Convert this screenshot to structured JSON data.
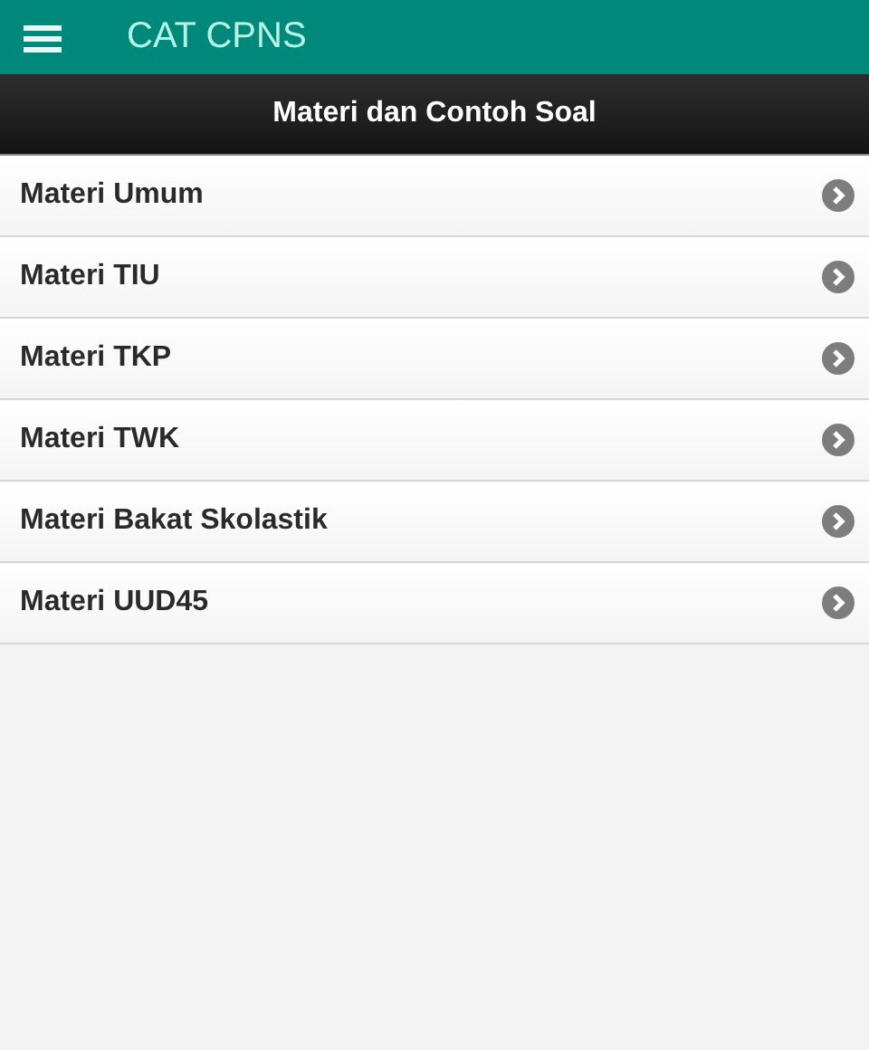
{
  "app_bar": {
    "title": "CAT CPNS"
  },
  "header": {
    "title": "Materi dan Contoh Soal"
  },
  "items": [
    {
      "label": "Materi Umum"
    },
    {
      "label": "Materi TIU"
    },
    {
      "label": "Materi TKP"
    },
    {
      "label": "Materi TWK"
    },
    {
      "label": "Materi Bakat Skolastik"
    },
    {
      "label": "Materi UUD45"
    }
  ]
}
